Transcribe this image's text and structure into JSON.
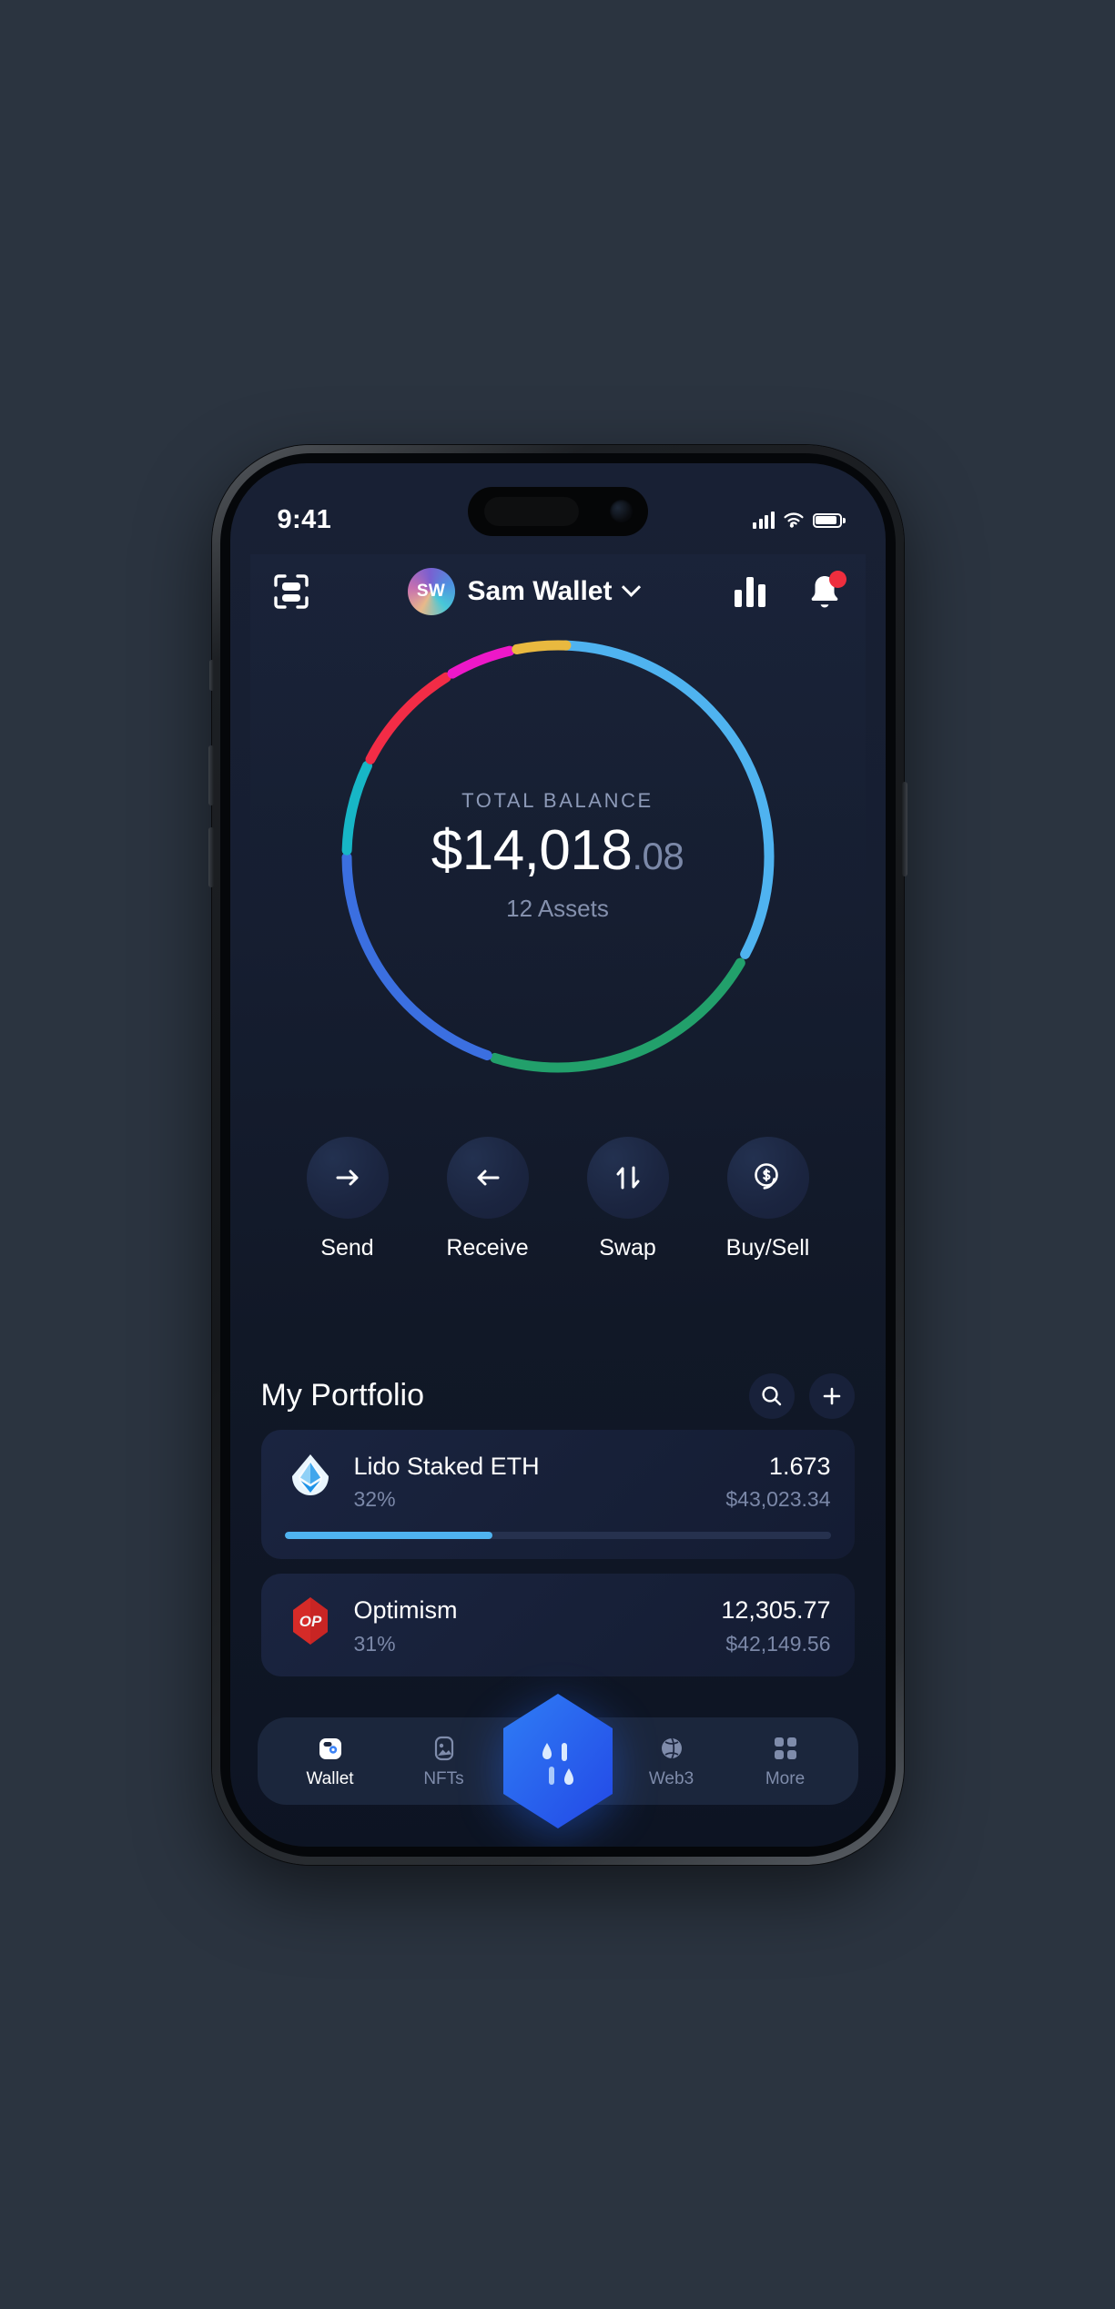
{
  "status_bar": {
    "time": "9:41",
    "signal_icon": "cellular-bars-icon",
    "wifi_icon": "wifi-icon",
    "battery_icon": "battery-icon"
  },
  "header": {
    "scan_icon": "scan-icon",
    "avatar_initials": "SW",
    "wallet_name": "Sam Wallet",
    "chevron_icon": "chevron-down-icon",
    "chart_icon": "bar-chart-icon",
    "bell_icon": "notification-bell-icon",
    "has_notification": true
  },
  "balance": {
    "label": "TOTAL BALANCE",
    "amount_whole": "$14,018",
    "amount_cents": ".08",
    "assets_count": "12 Assets"
  },
  "actions": [
    {
      "label": "Send",
      "icon": "arrow-right-icon"
    },
    {
      "label": "Receive",
      "icon": "arrow-left-icon"
    },
    {
      "label": "Swap",
      "icon": "swap-arrows-icon"
    },
    {
      "label": "Buy/Sell",
      "icon": "dollar-coin-icon"
    }
  ],
  "portfolio": {
    "title": "My Portfolio",
    "search_icon": "search-icon",
    "add_icon": "plus-icon",
    "assets": [
      {
        "name": "Lido Staked ETH",
        "percent": "32%",
        "quantity": "1.673",
        "value": "$43,023.34",
        "bar_pct": 38,
        "bar_color": "#4FB3F0",
        "icon": "lido-icon"
      },
      {
        "name": "Optimism",
        "percent": "31%",
        "quantity": "12,305.77",
        "value": "$42,149.56",
        "bar_pct": 0,
        "bar_color": "#E03A43",
        "icon": "optimism-icon"
      }
    ]
  },
  "tabbar": {
    "items": [
      {
        "label": "Wallet",
        "icon": "wallet-icon",
        "active": true
      },
      {
        "label": "NFTs",
        "icon": "image-icon",
        "active": false
      },
      {
        "label": "Web3",
        "icon": "globe-icon",
        "active": false
      },
      {
        "label": "More",
        "icon": "grid-icon",
        "active": false
      }
    ],
    "fab_icon": "hexagon-token-icon"
  },
  "chart_data": {
    "type": "pie",
    "title": "Portfolio allocation donut",
    "categories": [
      "Green asset",
      "Blue asset",
      "Teal asset",
      "Red asset",
      "Magenta asset",
      "Yellow asset",
      "Light blue asset"
    ],
    "values": [
      22,
      20,
      7,
      9,
      5,
      4,
      33
    ],
    "colors": [
      "#22A06B",
      "#3B6FE0",
      "#17B6C6",
      "#F22C46",
      "#ED18C8",
      "#E9B93F",
      "#4FB3F0"
    ],
    "legend": "none",
    "center_label": "TOTAL BALANCE",
    "center_value": "$14,018.08",
    "center_sub": "12 Assets"
  }
}
